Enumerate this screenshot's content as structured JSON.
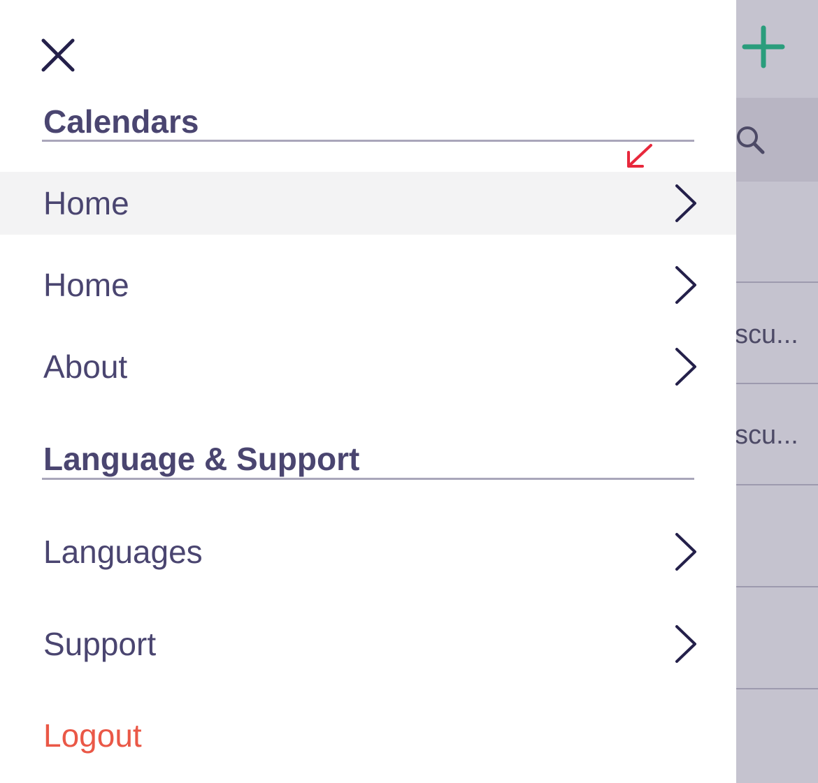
{
  "drawer": {
    "close_icon": "close-icon",
    "sections": [
      {
        "title": "Calendars",
        "items": [
          {
            "label": "Home",
            "active": true
          },
          {
            "label": "Home",
            "active": false
          },
          {
            "label": "About",
            "active": false
          }
        ]
      },
      {
        "title": "Language & Support",
        "items": [
          {
            "label": "Languages"
          },
          {
            "label": "Support"
          }
        ]
      }
    ],
    "logout_label": "Logout"
  },
  "background_app": {
    "add_icon": "plus-icon",
    "search_icon": "search-icon",
    "rows": [
      "scu...",
      "scu..."
    ]
  },
  "colors": {
    "text": "#4a4570",
    "chevron": "#24204a",
    "logout": "#ea5847",
    "active_row": "#f3f3f4",
    "overlay": "#c5c3cf",
    "accent_green": "#2a9d7c",
    "annotation_red": "#e8283c"
  }
}
